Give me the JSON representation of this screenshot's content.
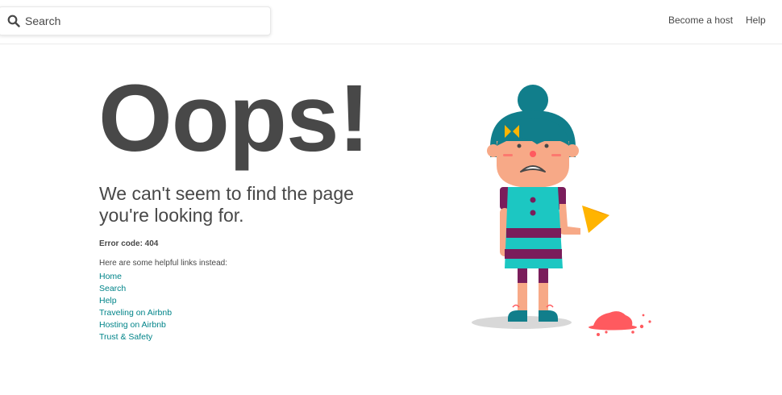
{
  "header": {
    "search": {
      "placeholder": "Search",
      "icon": "search-icon"
    },
    "nav": [
      {
        "label": "Become a host"
      },
      {
        "label": "Help"
      }
    ]
  },
  "main": {
    "title": "Oops!",
    "subtitle": "We can't seem to find the page you're looking for.",
    "error_code": "Error code: 404",
    "links_intro": "Here are some helpful links instead:",
    "links": [
      {
        "label": "Home"
      },
      {
        "label": "Search"
      },
      {
        "label": "Help"
      },
      {
        "label": "Traveling on Airbnb"
      },
      {
        "label": "Hosting on Airbnb"
      },
      {
        "label": "Trust & Safety"
      }
    ]
  },
  "colors": {
    "text": "#484848",
    "link": "#008489",
    "hair": "#117e8b",
    "dress": "#1cc7c2",
    "stripe": "#7a1d5b",
    "skin": "#f7a987",
    "ice_cream": "#ff5a5f",
    "cone": "#ffb400"
  }
}
